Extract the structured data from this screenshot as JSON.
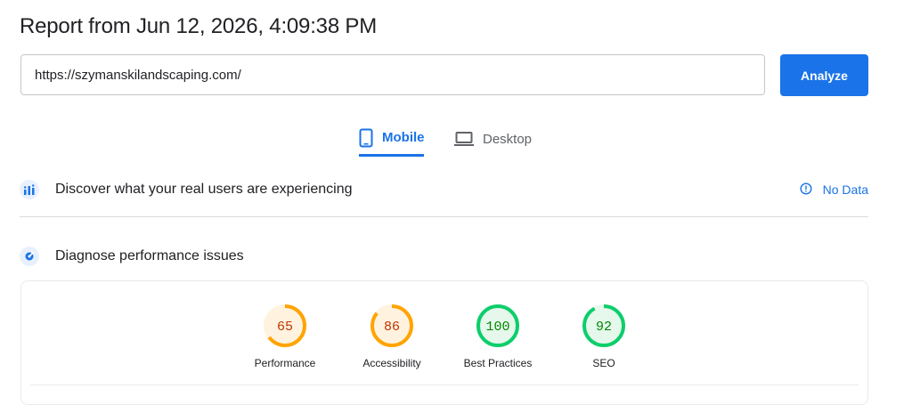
{
  "header": {
    "title": "Report from Jun 12, 2026, 4:09:38 PM"
  },
  "search": {
    "url_value": "https://szymanskilandscaping.com/",
    "analyze_label": "Analyze"
  },
  "tabs": [
    {
      "label": "Mobile",
      "icon": "smartphone-icon",
      "active": true
    },
    {
      "label": "Desktop",
      "icon": "laptop-icon",
      "active": false
    }
  ],
  "sections": {
    "real_users": {
      "title": "Discover what your real users are experiencing",
      "icon": "users-chart-icon",
      "status": "No Data",
      "status_icon": "info-icon"
    },
    "diagnose": {
      "title": "Diagnose performance issues",
      "icon": "lab-flask-icon"
    }
  },
  "scores": [
    {
      "label": "Performance",
      "value": 65,
      "status": "average"
    },
    {
      "label": "Accessibility",
      "value": 86,
      "status": "average"
    },
    {
      "label": "Best Practices",
      "value": 100,
      "status": "good"
    },
    {
      "label": "SEO",
      "value": 92,
      "status": "good"
    }
  ],
  "colors": {
    "accent": "#1a73e8",
    "average_stroke": "#ffa400",
    "average_fill": "#fff3e0",
    "average_text": "#c33300",
    "good_stroke": "#0cce6b",
    "good_fill": "#e6f7ec",
    "good_text": "#008800"
  }
}
